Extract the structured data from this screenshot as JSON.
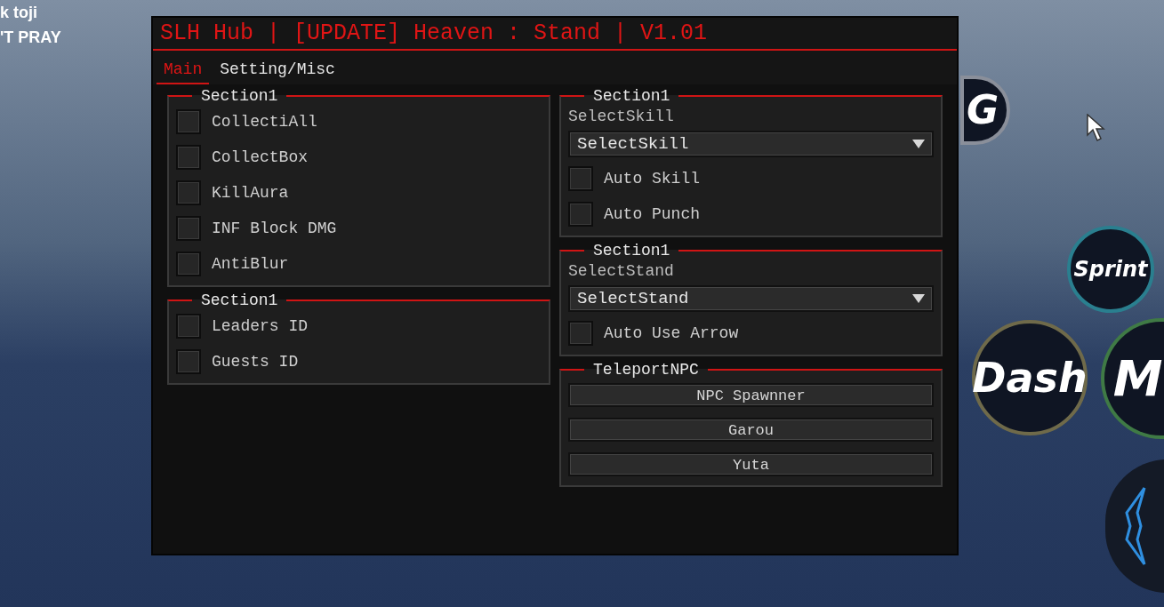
{
  "hud": {
    "top_left_lines": [
      "k toji",
      "'T PRAY"
    ],
    "buttons": [
      {
        "label": "G"
      },
      {
        "label": "Sprint"
      },
      {
        "label": "Dash"
      },
      {
        "label": "M"
      }
    ]
  },
  "window": {
    "title": "SLH Hub | [UPDATE] Heaven : Stand | V1.01",
    "tabs": [
      {
        "label": "Main",
        "selected": true
      },
      {
        "label": "Setting/Misc",
        "selected": false
      }
    ],
    "left_sections": [
      {
        "title": "Section1",
        "items": [
          {
            "kind": "toggle",
            "label": "CollectiAll",
            "checked": false
          },
          {
            "kind": "toggle",
            "label": "CollectBox",
            "checked": false
          },
          {
            "kind": "toggle",
            "label": "KillAura",
            "checked": false
          },
          {
            "kind": "toggle",
            "label": "INF Block DMG",
            "checked": false
          },
          {
            "kind": "toggle",
            "label": "AntiBlur",
            "checked": false
          }
        ]
      },
      {
        "title": "Section1",
        "items": [
          {
            "kind": "toggle",
            "label": "Leaders ID",
            "checked": false
          },
          {
            "kind": "toggle",
            "label": "Guests ID",
            "checked": false
          }
        ]
      }
    ],
    "right_sections": [
      {
        "title": "Section1",
        "items": [
          {
            "kind": "dropdown",
            "label": "SelectSkill",
            "value": "SelectSkill"
          },
          {
            "kind": "toggle",
            "label": "Auto Skill",
            "checked": false
          },
          {
            "kind": "toggle",
            "label": "Auto Punch",
            "checked": false
          }
        ]
      },
      {
        "title": "Section1",
        "items": [
          {
            "kind": "dropdown",
            "label": "SelectStand",
            "value": "SelectStand"
          },
          {
            "kind": "toggle",
            "label": "Auto Use Arrow",
            "checked": false
          }
        ]
      },
      {
        "title": "TeleportNPC",
        "items": [
          {
            "kind": "button",
            "label": "NPC Spawnner"
          },
          {
            "kind": "button",
            "label": "Garou"
          },
          {
            "kind": "button",
            "label": "Yuta"
          }
        ]
      }
    ]
  }
}
